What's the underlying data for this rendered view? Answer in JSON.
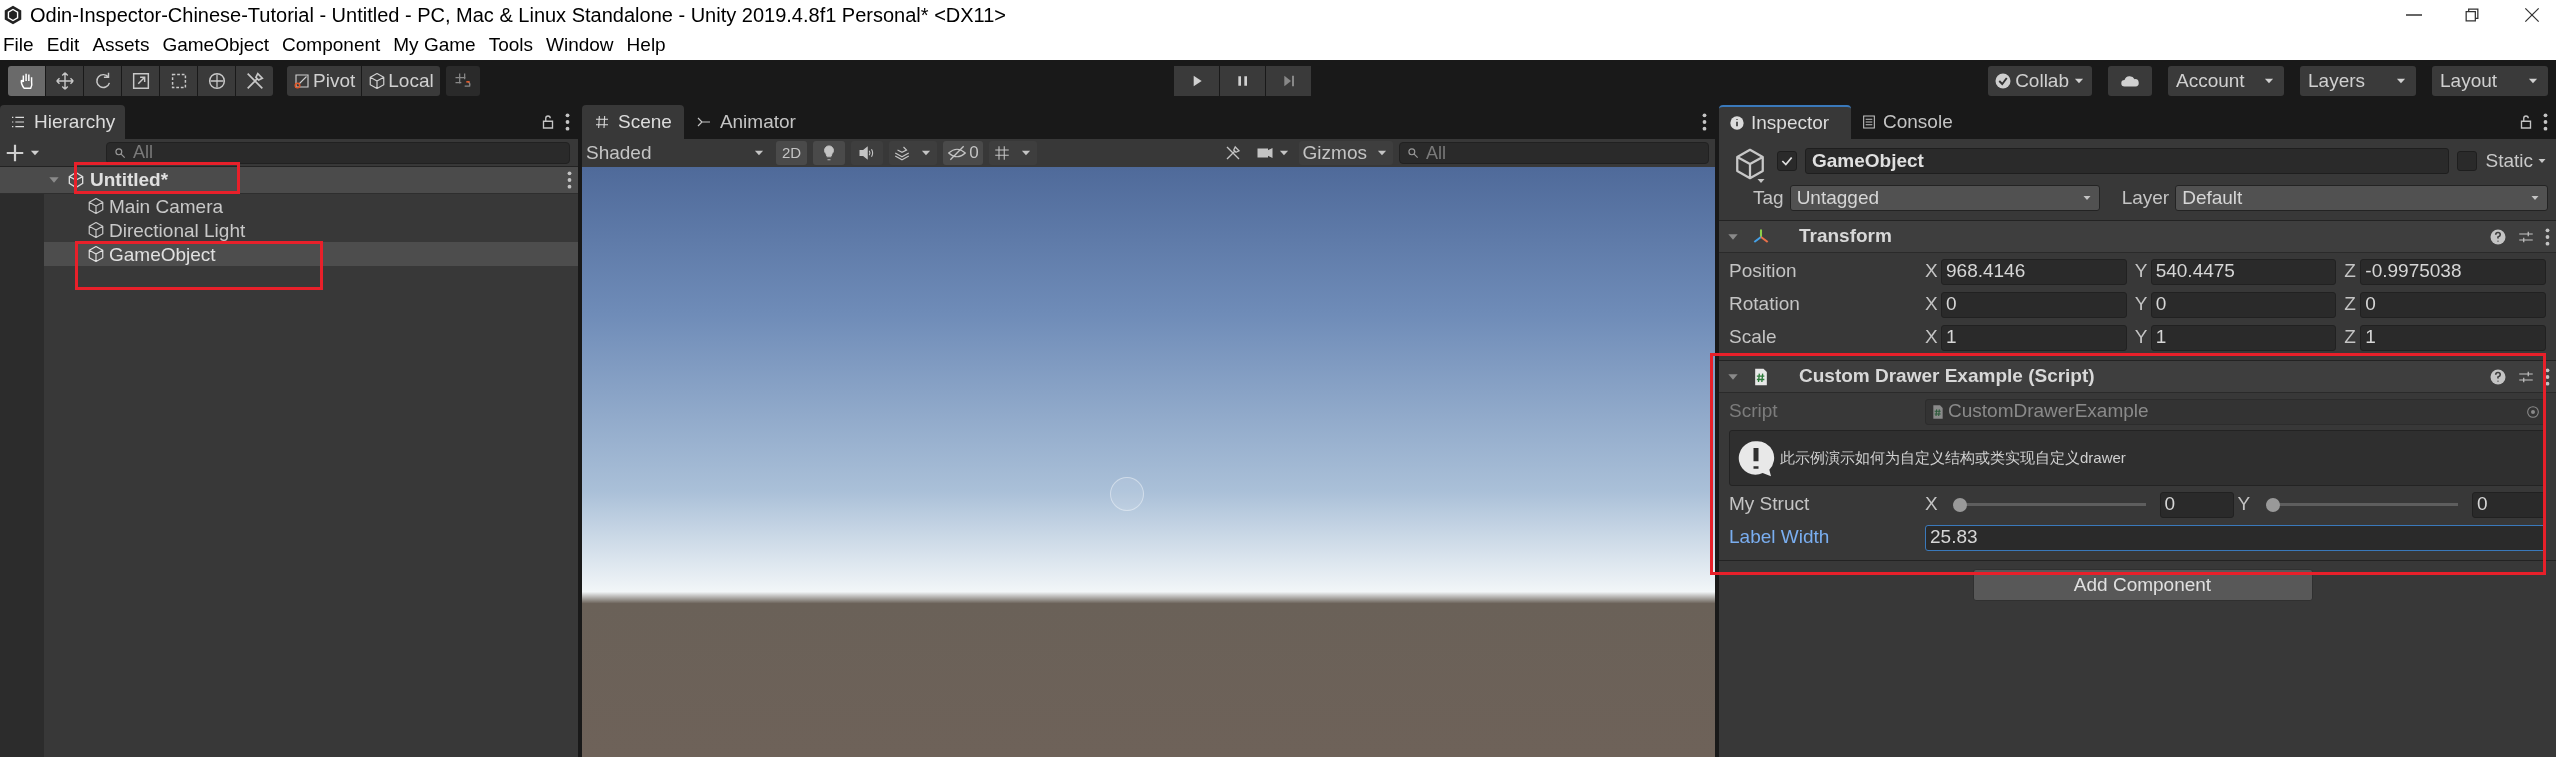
{
  "window": {
    "title": "Odin-Inspector-Chinese-Tutorial - Untitled - PC, Mac & Linux Standalone - Unity 2019.4.8f1 Personal* <DX11>"
  },
  "menu": [
    "File",
    "Edit",
    "Assets",
    "GameObject",
    "Component",
    "My Game",
    "Tools",
    "Window",
    "Help"
  ],
  "toolbar": {
    "tools": [
      {
        "kind": "hand",
        "selected": true
      },
      {
        "kind": "move",
        "selected": false
      },
      {
        "kind": "rotate",
        "selected": false
      },
      {
        "kind": "scale",
        "selected": false
      },
      {
        "kind": "rect",
        "selected": false
      },
      {
        "kind": "transform",
        "selected": false
      },
      {
        "kind": "custom",
        "selected": false
      }
    ],
    "pivot": "Pivot",
    "local": "Local",
    "collab": "Collab",
    "account": "Account",
    "layers": "Layers",
    "layout": "Layout"
  },
  "hierarchy": {
    "title": "Hierarchy",
    "search_placeholder": "All",
    "scene": {
      "label": "Untitled*",
      "expanded": true
    },
    "items": [
      {
        "label": "Main Camera",
        "selected": false
      },
      {
        "label": "Directional Light",
        "selected": false
      },
      {
        "label": "GameObject",
        "selected": true
      }
    ]
  },
  "scene_view": {
    "tabs": [
      {
        "label": "Scene",
        "selected": true
      },
      {
        "label": "Animator",
        "selected": false
      }
    ],
    "shading": "Shaded",
    "mode_2d": "2D",
    "hidden_count": "0",
    "gizmos": "Gizmos",
    "search_placeholder": "All"
  },
  "inspector": {
    "tabs": [
      {
        "label": "Inspector",
        "selected": true
      },
      {
        "label": "Console",
        "selected": false
      }
    ],
    "object": {
      "active": true,
      "name": "GameObject",
      "static_label": "Static",
      "static": false,
      "tag_label": "Tag",
      "tag": "Untagged",
      "layer_label": "Layer",
      "layer": "Default"
    },
    "components": [
      {
        "kind": "transform",
        "title": "Transform",
        "expanded": true,
        "rows": [
          {
            "kind": "vector3",
            "label": "Position",
            "values": [
              {
                "axis": "X",
                "value": "968.4146"
              },
              {
                "axis": "Y",
                "value": "540.4475"
              },
              {
                "axis": "Z",
                "value": "-0.9975038"
              }
            ]
          },
          {
            "kind": "vector3",
            "label": "Rotation",
            "values": [
              {
                "axis": "X",
                "value": "0"
              },
              {
                "axis": "Y",
                "value": "0"
              },
              {
                "axis": "Z",
                "value": "0"
              }
            ]
          },
          {
            "kind": "vector3",
            "label": "Scale",
            "values": [
              {
                "axis": "X",
                "value": "1"
              },
              {
                "axis": "Y",
                "value": "1"
              },
              {
                "axis": "Z",
                "value": "1"
              }
            ]
          }
        ]
      },
      {
        "kind": "script",
        "title": "Custom Drawer Example (Script)",
        "expanded": true,
        "rows": [
          {
            "kind": "object_ref",
            "label": "Script",
            "value": "CustomDrawerExample",
            "disabled": true
          },
          {
            "kind": "info_box",
            "text": "此示例演示如何为自定义结构或类实现自定义drawer"
          },
          {
            "kind": "slider_pair",
            "label": "My Struct",
            "values": [
              {
                "axis": "X",
                "level": 0,
                "value": "0"
              },
              {
                "axis": "Y",
                "level": 0,
                "value": "0"
              }
            ]
          },
          {
            "kind": "float",
            "label": "Label Width",
            "value": "25.83",
            "focused": true
          }
        ]
      }
    ],
    "add_component": "Add Component"
  }
}
